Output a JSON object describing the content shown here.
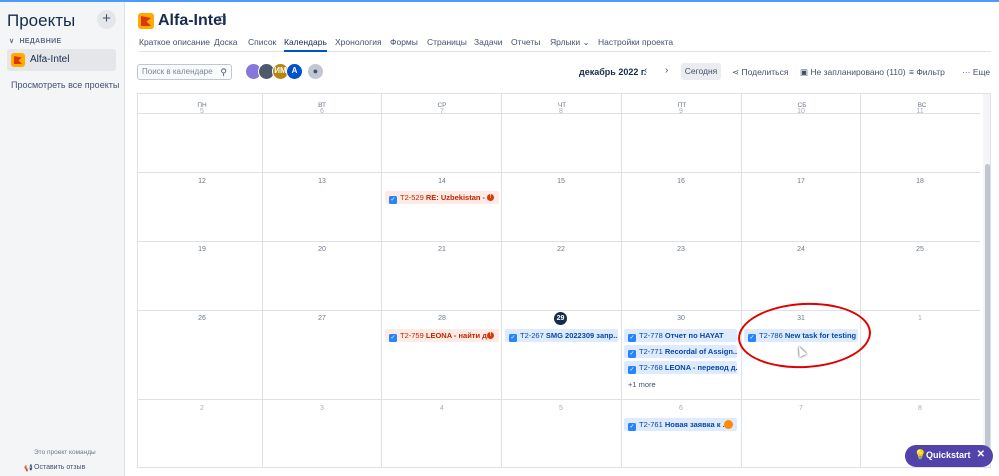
{
  "sidebar": {
    "title": "Проекты",
    "add_label": "+",
    "recent_label": "НЕДАВНИЕ",
    "project_name": "Alfa-Intel",
    "view_all": "Просмотреть все проекты",
    "footer_note": "Это проект команды",
    "feedback": "Оставить отзыв"
  },
  "header": {
    "project_title": "Alfa-Intel",
    "tabs": [
      {
        "label": "Краткое описание"
      },
      {
        "label": "Доска"
      },
      {
        "label": "Список"
      },
      {
        "label": "Календарь"
      },
      {
        "label": "Хронология"
      },
      {
        "label": "Формы"
      },
      {
        "label": "Страницы"
      },
      {
        "label": "Задачи"
      },
      {
        "label": "Отчеты"
      },
      {
        "label": "Ярлыки ⌄"
      },
      {
        "label": "Настройки проекта"
      }
    ],
    "active_tab": "Календарь"
  },
  "toolbar": {
    "search_placeholder": "Поиск в календаре",
    "avatars": [
      {
        "initials": "",
        "color": "#8777d9"
      },
      {
        "initials": "",
        "color": "#4c5a6e"
      },
      {
        "initials": "ИМ",
        "color": "#b8860b"
      },
      {
        "initials": "A",
        "color": "#0052cc"
      },
      {
        "initials": "",
        "color": "#c1c7d0"
      }
    ],
    "month_label": "декабрь 2022 г.",
    "prev": "‹",
    "next": "›",
    "today": "Сегодня",
    "share": "Поделиться",
    "unscheduled": "Не запланировано (110)",
    "filter": "Фильтр",
    "more": "Еще"
  },
  "calendar": {
    "weekdays": [
      "ПН",
      "ВТ",
      "СР",
      "ЧТ",
      "ПТ",
      "СБ",
      "ВС"
    ],
    "weeks": [
      [
        "5",
        "6",
        "7",
        "8",
        "9",
        "10",
        "11"
      ],
      [
        "12",
        "13",
        "14",
        "15",
        "16",
        "17",
        "18"
      ],
      [
        "19",
        "20",
        "21",
        "22",
        "23",
        "24",
        "25"
      ],
      [
        "26",
        "27",
        "28",
        "29",
        "30",
        "31",
        "1"
      ],
      [
        "2",
        "3",
        "4",
        "5",
        "6",
        "7",
        "8"
      ]
    ],
    "today": "29",
    "events": {
      "e1": {
        "key": "T2-529",
        "summary": "RE: Uzbekistan - ..."
      },
      "e2": {
        "key": "T2-759",
        "summary": "LEONA - найти д..."
      },
      "e3": {
        "key": "T2-267",
        "summary": "SMG 2022309 запр..."
      },
      "e4": {
        "key": "T2-778",
        "summary": "Отчет по HAYAT"
      },
      "e5": {
        "key": "T2-771",
        "summary": "Recordal of Assign..."
      },
      "e6": {
        "key": "T2-768",
        "summary": "LEONA - перевод д..."
      },
      "e7": {
        "key": "T2-786",
        "summary": "New task for testing"
      },
      "e8": {
        "key": "T2-761",
        "summary": "Новая заявка к ..."
      }
    },
    "more_label": "+1 more"
  },
  "quickstart": {
    "label": "Quickstart",
    "close": "✕"
  },
  "colors": {
    "accent": "#0052cc",
    "quickstart": "#5243aa",
    "event_blue": "#deebff",
    "event_red": "#ffebe6",
    "annotation": "#e00000"
  }
}
